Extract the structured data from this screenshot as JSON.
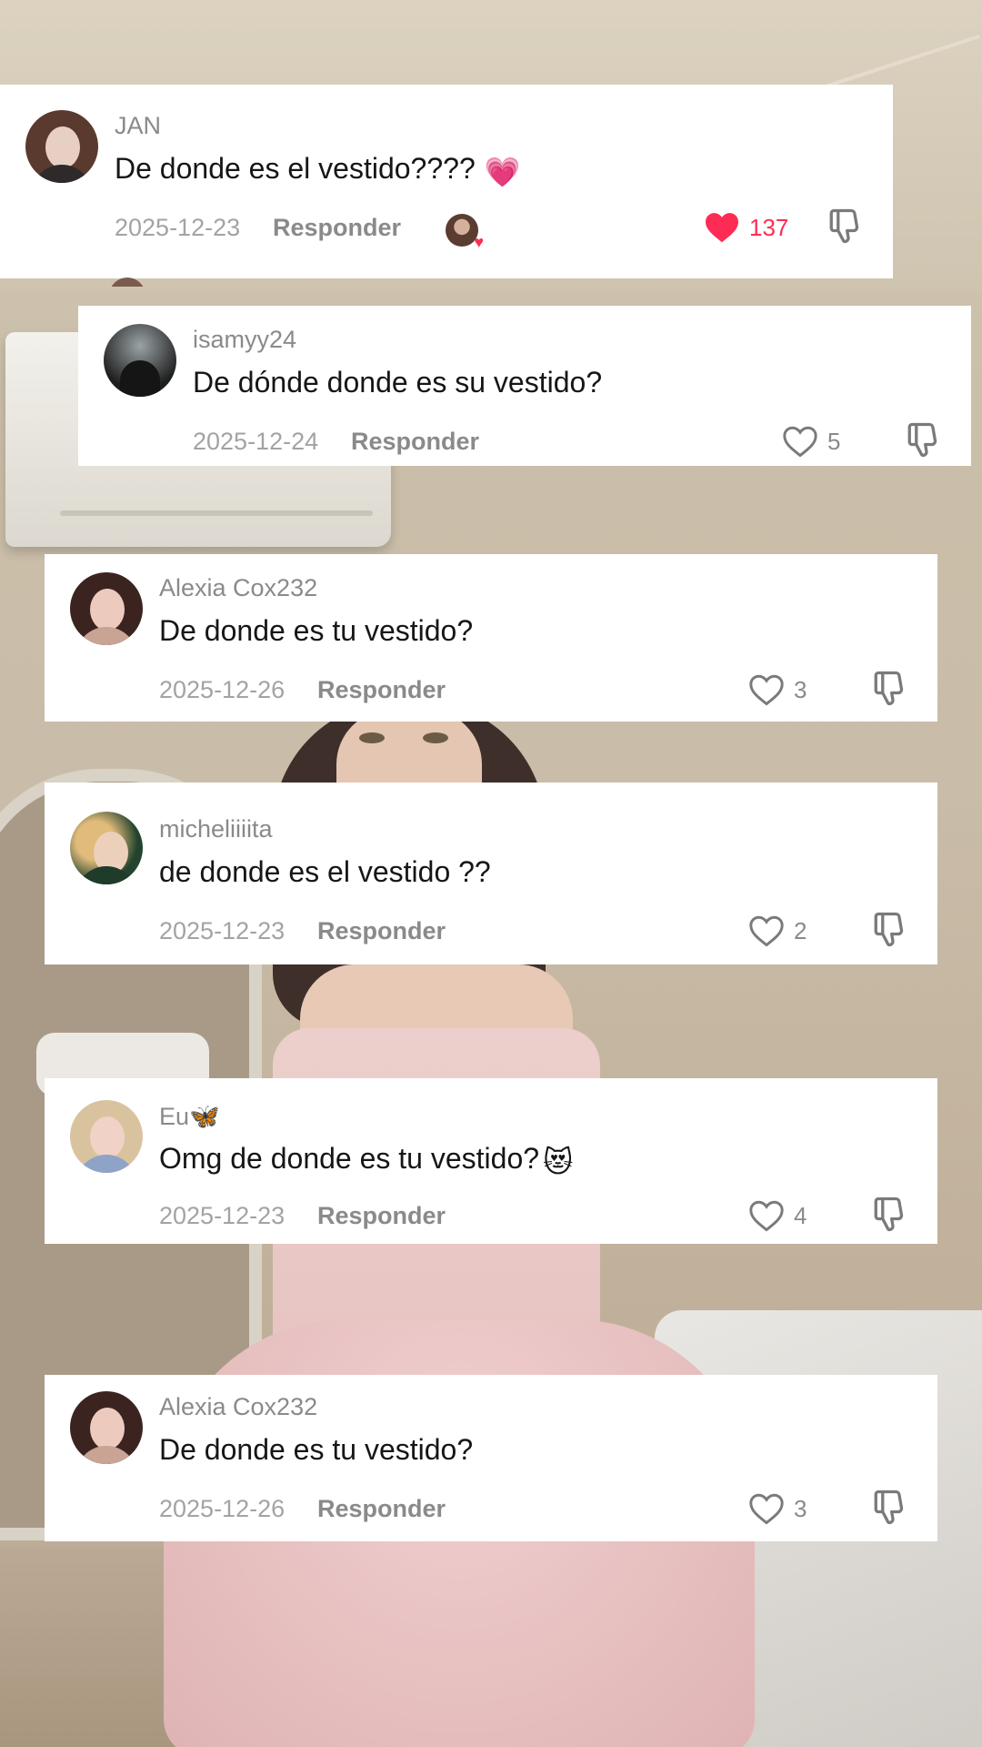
{
  "comments": [
    {
      "username": "JAN",
      "text": "De donde es el vestido????",
      "emoji": "💗",
      "date": "2025-12-23",
      "reply_label": "Responder",
      "likes": "137",
      "liked": true,
      "creator_liked": true
    },
    {
      "username": "isamyy24",
      "text": "De dónde donde es su vestido?",
      "date": "2025-12-24",
      "reply_label": "Responder",
      "likes": "5"
    },
    {
      "username": "Alexia Cox232",
      "text": "De donde es tu vestido?",
      "date": "2025-12-26",
      "reply_label": "Responder",
      "likes": "3"
    },
    {
      "username": "micheliiiita",
      "text": "de donde es el vestido ??",
      "date": "2025-12-23",
      "reply_label": "Responder",
      "likes": "2"
    },
    {
      "username": "Eu",
      "username_emoji": "🦋",
      "text": "Omg de donde es tu vestido?",
      "emoji": "😻",
      "date": "2025-12-23",
      "reply_label": "Responder",
      "likes": "4"
    },
    {
      "username": "Alexia Cox232",
      "text": "De donde es tu vestido?",
      "date": "2025-12-26",
      "reply_label": "Responder",
      "likes": "3"
    }
  ],
  "colors": {
    "like_active": "#fe2c55",
    "muted_text": "#8a8a8a",
    "date_text": "#a3a3a3",
    "body_text": "#161616"
  },
  "icons": {
    "like": "heart-outline-icon",
    "like_active": "heart-filled-icon",
    "dislike": "thumbs-down-icon"
  }
}
